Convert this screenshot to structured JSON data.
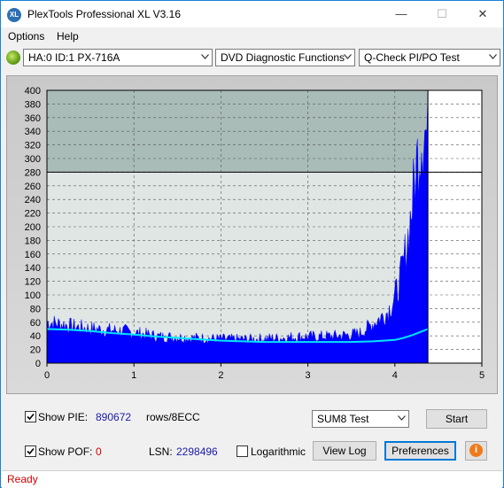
{
  "window": {
    "title": "PlexTools Professional XL V3.16",
    "app_icon_text": "XL",
    "controls": {
      "minimize": "—",
      "maximize": "☐",
      "close": "✕"
    }
  },
  "menu": {
    "items": [
      "Options",
      "Help"
    ]
  },
  "toolbar": {
    "drive": "HA:0 ID:1  PX-716A",
    "function": "DVD Diagnostic Functions",
    "test": "Q-Check PI/PO Test"
  },
  "chart_data": {
    "type": "area",
    "x_ticks": [
      "0",
      "1",
      "2",
      "3",
      "4",
      "5"
    ],
    "y_ticks": [
      "0",
      "20",
      "40",
      "60",
      "80",
      "100",
      "120",
      "140",
      "160",
      "180",
      "200",
      "220",
      "240",
      "260",
      "280",
      "300",
      "320",
      "340",
      "360",
      "380",
      "400"
    ],
    "xlim": [
      0,
      5
    ],
    "ylim": [
      0,
      400
    ],
    "threshold": 280,
    "data_end_x": 4.38,
    "grid": true,
    "series": [
      {
        "color": "#0000ff",
        "x": [
          0,
          0.1,
          0.2,
          0.3,
          0.5,
          0.7,
          0.9,
          1.1,
          1.3,
          1.5,
          1.7,
          1.9,
          2.1,
          2.3,
          2.5,
          2.7,
          2.9,
          3.1,
          3.3,
          3.5,
          3.6,
          3.7,
          3.8,
          3.9,
          3.95,
          4.0,
          4.05,
          4.1,
          4.15,
          4.2,
          4.25,
          4.3,
          4.33,
          4.36,
          4.38
        ],
        "y": [
          62,
          60,
          58,
          55,
          52,
          50,
          48,
          44,
          40,
          39,
          38,
          37,
          36,
          36,
          37,
          38,
          40,
          40,
          41,
          43,
          45,
          55,
          65,
          75,
          85,
          100,
          120,
          150,
          190,
          240,
          300,
          340,
          355,
          345,
          340
        ]
      },
      {
        "color": "#00e5ff",
        "x": [
          0,
          0.25,
          0.5,
          0.75,
          1,
          1.25,
          1.5,
          1.75,
          2,
          2.25,
          2.5,
          2.75,
          3,
          3.25,
          3.5,
          3.75,
          4,
          4.1,
          4.2,
          4.3,
          4.38
        ],
        "y": [
          50,
          49,
          47,
          44,
          42,
          39,
          37,
          35,
          33,
          32,
          31,
          31,
          31,
          31,
          31,
          32,
          34,
          37,
          41,
          46,
          50
        ]
      }
    ]
  },
  "controls": {
    "show_pie_label": "Show PIE:",
    "show_pie_checked": true,
    "pie_value": "890672",
    "rows_label": "rows/8ECC",
    "show_pof_label": "Show POF:",
    "show_pof_checked": true,
    "pof_value": "0",
    "lsn_label": "LSN:",
    "lsn_value": "2298496",
    "logarithmic_label": "Logarithmic",
    "logarithmic_checked": false,
    "sum_select": "SUM8 Test",
    "start_button": "Start",
    "view_log_button": "View Log",
    "preferences_button": "Preferences",
    "info_icon": "i"
  },
  "status": {
    "text": "Ready"
  }
}
